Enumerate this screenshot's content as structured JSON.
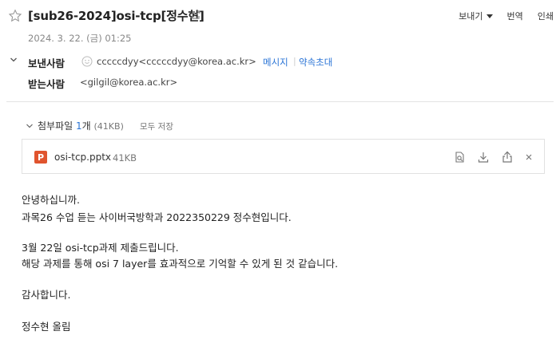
{
  "header": {
    "subject": "[sub26-2024]osi-tcp[정수현]",
    "date": "2024. 3. 22. (금) 01:25",
    "actions": {
      "send": "보내기",
      "translate": "번역",
      "print": "인쇄"
    }
  },
  "from": {
    "label": "보낸사람",
    "address": "cccccdyy<cccccdyy@korea.ac.kr>",
    "message_link": "메시지",
    "separator": "|",
    "appointment_link": "약속초대"
  },
  "to": {
    "label": "받는사람",
    "address": "<gilgil@korea.ac.kr>"
  },
  "attachments": {
    "title": "첨부파일",
    "count": "1",
    "count_suffix": "개",
    "total_size": "(41KB)",
    "save_all": "모두 저장",
    "file": {
      "name": "osi-tcp.pptx",
      "size": "41KB"
    }
  },
  "body": {
    "lines": [
      "안녕하십니까.",
      "과목26 수업 듣는 사이버국방학과 2022350229 정수현입니다.",
      "3월 22일 osi-tcp과제 제출드립니다.",
      "해당 과제를 통해 osi 7 layer를 효과적으로 기억할 수 있게 된 것 같습니다.",
      "감사합니다.",
      "정수현 올림"
    ]
  },
  "colors": {
    "link": "#2a74d6",
    "ppt": "#e0542e"
  }
}
